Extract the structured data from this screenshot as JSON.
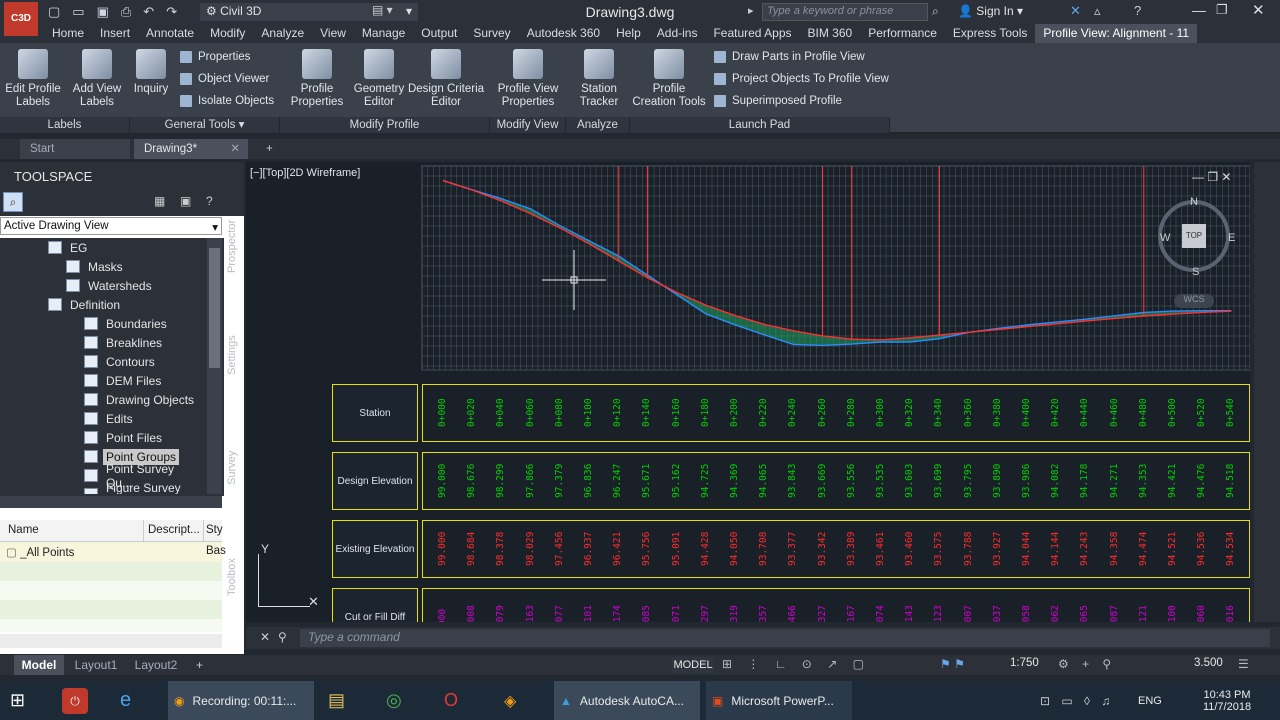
{
  "app": {
    "name": "Civil 3D",
    "title": "Drawing3.dwg",
    "search_placeholder": "Type a keyword or phrase",
    "sign_in": "Sign In"
  },
  "ribbon_tabs": [
    "Home",
    "Insert",
    "Annotate",
    "Modify",
    "Analyze",
    "View",
    "Manage",
    "Output",
    "Survey",
    "Autodesk 360",
    "Help",
    "Add-ins",
    "Featured Apps",
    "BIM 360",
    "Performance",
    "Express Tools",
    "Profile View: Alignment - 11"
  ],
  "ribbon": {
    "buttons": [
      {
        "label1": "Edit Profile",
        "label2": "Labels"
      },
      {
        "label1": "Add View",
        "label2": "Labels"
      },
      {
        "label1": "Inquiry",
        "label2": ""
      },
      {
        "label1": "Profile",
        "label2": "Properties"
      },
      {
        "label1": "Geometry",
        "label2": "Editor"
      },
      {
        "label1": "Design Criteria",
        "label2": "Editor"
      },
      {
        "label1": "Profile View",
        "label2": "Properties"
      },
      {
        "label1": "Station",
        "label2": "Tracker"
      },
      {
        "label1": "Profile",
        "label2": "Creation Tools"
      }
    ],
    "small": [
      "Properties",
      "Object Viewer",
      "Isolate Objects",
      "Draw Parts in Profile View",
      "Project Objects To Profile View",
      "Superimposed Profile"
    ],
    "groups": [
      "Labels",
      "General Tools",
      "Modify Profile",
      "Modify View",
      "Analyze",
      "Launch Pad"
    ]
  },
  "doc_tabs": [
    "Start",
    "Drawing3*"
  ],
  "toolspace": {
    "title": "TOOLSPACE",
    "view": "Active Drawing View",
    "side_tabs": [
      "Prospector",
      "Settings",
      "Survey",
      "Toolbox"
    ],
    "tree": [
      "EG",
      "Masks",
      "Watersheds",
      "Definition",
      "Boundaries",
      "Breaklines",
      "Contours",
      "DEM Files",
      "Drawing Objects",
      "Edits",
      "Point Files",
      "Point Groups",
      "Point Survey Qu...",
      "Figure Survey Q..."
    ],
    "columns": [
      "Name",
      "Descript...",
      "Sty"
    ],
    "rows": [
      {
        "name": "_All Points",
        "style": "Bas"
      }
    ]
  },
  "viewport": {
    "label": "[−][Top][2D Wireframe]",
    "compass": {
      "n": "N",
      "s": "S",
      "e": "E",
      "w": "W",
      "top": "TOP",
      "wcs": "WCS"
    },
    "band_labels": [
      "Station",
      "Design Elevation",
      "Existing Elevation",
      "Cut or Fill Diff"
    ],
    "stations": [
      "0+000",
      "0+020",
      "0+040",
      "0+060",
      "0+080",
      "0+100",
      "0+120",
      "0+140",
      "0+160",
      "0+180",
      "0+200",
      "0+220",
      "0+240",
      "0+260",
      "0+280",
      "0+300",
      "0+320",
      "0+340",
      "0+360",
      "0+380",
      "0+400",
      "0+420",
      "0+440",
      "0+460",
      "0+480",
      "0+500",
      "0+520",
      "0+540"
    ],
    "design": [
      "99.000",
      "98.676",
      "98.299",
      "97.866",
      "97.379",
      "96.836",
      "96.247",
      "95.671",
      "95.162",
      "94.725",
      "94.369",
      "94.065",
      "93.843",
      "93.669",
      "93.556",
      "93.535",
      "93.603",
      "93.699",
      "93.795",
      "93.890",
      "93.986",
      "94.082",
      "94.178",
      "94.271",
      "94.353",
      "94.421",
      "94.476",
      "94.518"
    ],
    "existing": [
      "99.000",
      "98.684",
      "98.378",
      "98.029",
      "97.456",
      "96.937",
      "96.421",
      "95.756",
      "95.091",
      "94.428",
      "94.050",
      "93.708",
      "93.377",
      "93.342",
      "93.389",
      "93.461",
      "93.460",
      "93.575",
      "93.788",
      "93.927",
      "94.044",
      "94.144",
      "94.243",
      "94.358",
      "94.474",
      "94.521",
      "94.536",
      "94.534"
    ],
    "cutfill": [
      "000",
      ".008",
      ".079",
      ".163",
      ".077",
      ".101",
      ".174",
      ".085",
      ".071",
      ".297",
      ".319",
      ".357",
      ".466",
      ".327",
      ".167",
      ".074",
      ".143",
      ".123",
      ".007",
      ".037",
      ".058",
      ".062",
      ".065",
      ".087",
      ".121",
      ".100",
      ".060",
      ".016"
    ]
  },
  "command_placeholder": "Type a command",
  "layout_tabs": [
    "Model",
    "Layout1",
    "Layout2"
  ],
  "status": {
    "model": "MODEL",
    "scale": "1:750",
    "value": "3.500"
  },
  "taskbar": {
    "items": [
      "Recording: 00:11:...",
      "Autodesk AutoCA...",
      "Microsoft PowerP..."
    ],
    "lang": "ENG",
    "time": "10:43 PM",
    "date": "11/7/2018"
  },
  "colors": {
    "accent": "#e8e000",
    "station": "#00d000",
    "design": "#00d000",
    "existing": "#ff2b2b",
    "cutfill": "#d000d0",
    "grid": "#5b6a7a",
    "eg": "#2a8cff",
    "fg": "#ff3030"
  }
}
